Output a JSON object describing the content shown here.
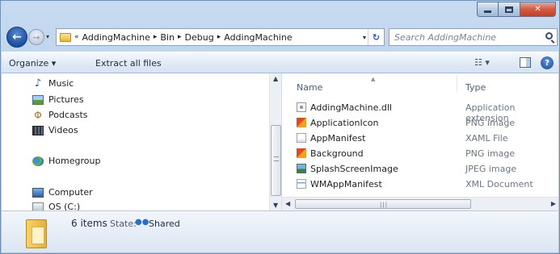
{
  "window": {
    "caption_buttons": [
      "minimize",
      "maximize",
      "close"
    ],
    "close_glyph": "✕"
  },
  "address_bar": {
    "overflow": "«",
    "crumbs": [
      "AddingMachine",
      "Bin",
      "Debug",
      "AddingMachine"
    ],
    "separator": "▸",
    "dropdown_glyph": "▾",
    "refresh_glyph": "↻"
  },
  "search": {
    "placeholder": "Search AddingMachine"
  },
  "toolbar": {
    "organize_label": "Organize ▾",
    "extract_label": "Extract all files",
    "views_label": "☷ ▾",
    "help_label": "?"
  },
  "nav_pane": {
    "items": [
      {
        "label": "Music",
        "icon": "music-icon"
      },
      {
        "label": "Pictures",
        "icon": "pictures-icon"
      },
      {
        "label": "Podcasts",
        "icon": "podcasts-icon"
      },
      {
        "label": "Videos",
        "icon": "videos-icon"
      },
      {
        "label": "Homegroup",
        "icon": "homegroup-icon"
      },
      {
        "label": "Computer",
        "icon": "computer-icon"
      },
      {
        "label": "OS (C:)",
        "icon": "drive-icon"
      }
    ]
  },
  "file_list": {
    "columns": [
      "Name",
      "Type"
    ],
    "files": [
      {
        "name": "AddingMachine.dll",
        "type": "Application extension",
        "icon": "dll-file-icon"
      },
      {
        "name": "ApplicationIcon",
        "type": "PNG image",
        "icon": "png-file-icon"
      },
      {
        "name": "AppManifest",
        "type": "XAML File",
        "icon": "xaml-file-icon"
      },
      {
        "name": "Background",
        "type": "PNG image",
        "icon": "png-file-icon"
      },
      {
        "name": "SplashScreenImage",
        "type": "JPEG image",
        "icon": "jpeg-file-icon"
      },
      {
        "name": "WMAppManifest",
        "type": "XML Document",
        "icon": "xml-file-icon"
      }
    ]
  },
  "details_pane": {
    "count": "6 items",
    "state_label": "State:",
    "state_value": "Shared"
  },
  "colors": {
    "frame": "#b6cde8",
    "accent": "#1d4fa0",
    "close": "#c2402a"
  }
}
